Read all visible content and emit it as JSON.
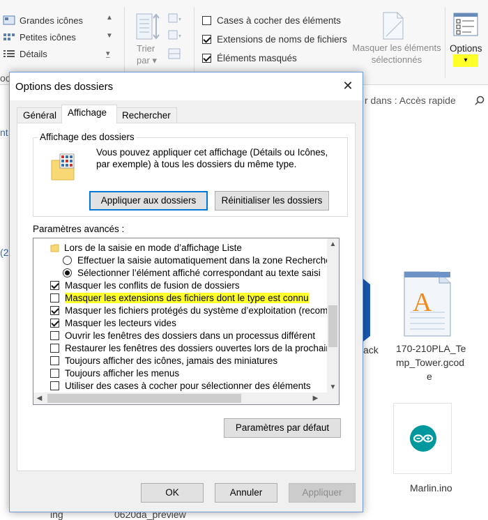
{
  "ribbon": {
    "layout_items": [
      "Grandes icônes",
      "Petites icônes",
      "Détails"
    ],
    "sort_label_1": "Trier",
    "sort_label_2": "par",
    "checks": [
      {
        "label": "Cases à cocher des éléments",
        "checked": false
      },
      {
        "label": "Extensions de noms de fichiers",
        "checked": true
      },
      {
        "label": "Éléments masqués",
        "checked": true
      }
    ],
    "hide_selected_1": "Masquer les éléments",
    "hide_selected_2": "sélectionnés",
    "options_label": "Options",
    "highlight_color": "#ffff2a"
  },
  "explorer": {
    "search_placeholder": "r dans : Accès rapide",
    "file1_caption": "ack",
    "file2_caption_1": "170-210PLA_Te",
    "file2_caption_2": "mp_Tower.gcod",
    "file2_caption_3": "e",
    "file3_caption": "Marlin.ino",
    "bottom_left_1": "ing",
    "bottom_left_2": "0620da_preview",
    "left_fragment_1": "oo",
    "left_fragment_2": "nt",
    "left_fragment_3": "(2"
  },
  "dialog": {
    "title": "Options des dossiers",
    "tabs": [
      "Général",
      "Affichage",
      "Rechercher"
    ],
    "active_tab": "Affichage",
    "folder_views": {
      "legend": "Affichage des dossiers",
      "description": "Vous pouvez appliquer cet affichage (Détails ou Icônes, par exemple) à tous les dossiers du même type.",
      "apply_button": "Appliquer aux dossiers",
      "reset_button": "Réinitialiser les dossiers"
    },
    "advanced": {
      "label": "Paramètres avancés :",
      "rows": [
        {
          "kind": "folder",
          "label": "Lors de la saisie en mode d’affichage Liste"
        },
        {
          "kind": "radio",
          "checked": false,
          "label": "Effectuer la saisie automatiquement dans la zone Recherche"
        },
        {
          "kind": "radio",
          "checked": true,
          "label": "Sélectionner l’élément affiché correspondant au texte saisi"
        },
        {
          "kind": "check",
          "checked": true,
          "label": "Masquer les conflits de fusion de dossiers"
        },
        {
          "kind": "check",
          "checked": false,
          "highlight": true,
          "label": "Masquer les extensions des fichiers dont le type est connu"
        },
        {
          "kind": "check",
          "checked": true,
          "label": "Masquer les fichiers protégés du système d’exploitation (recommandé)"
        },
        {
          "kind": "check",
          "checked": true,
          "label": "Masquer les lecteurs vides"
        },
        {
          "kind": "check",
          "checked": false,
          "label": "Ouvrir les fenêtres des dossiers dans un processus différent"
        },
        {
          "kind": "check",
          "checked": false,
          "label": "Restaurer les fenêtres des dossiers ouvertes lors de la prochaine ouverture de session"
        },
        {
          "kind": "check",
          "checked": false,
          "label": "Toujours afficher des icônes, jamais des miniatures"
        },
        {
          "kind": "check",
          "checked": false,
          "label": "Toujours afficher les menus"
        },
        {
          "kind": "check",
          "checked": false,
          "label": "Utiliser des cases à cocher pour sélectionner des éléments"
        }
      ]
    },
    "defaults_button": "Paramètres par défaut",
    "ok_button": "OK",
    "cancel_button": "Annuler",
    "apply_button": "Appliquer"
  }
}
